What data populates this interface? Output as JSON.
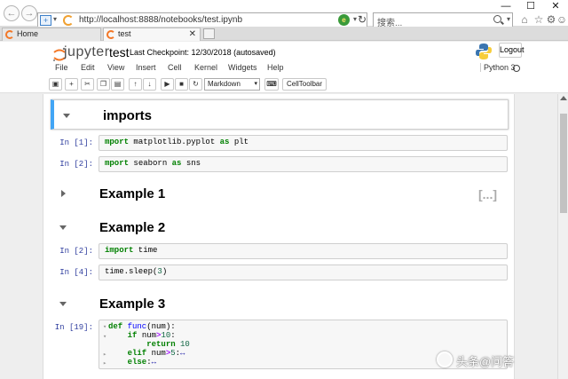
{
  "browser": {
    "url": "http://localhost:8888/notebooks/test.ipynb",
    "search_placeholder": "搜索...",
    "tabs": [
      {
        "label": "Home"
      },
      {
        "label": "test"
      }
    ],
    "window_controls": {
      "minimize": "—",
      "maximize": "☐",
      "close": "✕"
    }
  },
  "jupyter": {
    "logo_text": "jupyter",
    "notebook_name": "test",
    "checkpoint": "Last Checkpoint: 12/30/2018 (autosaved)",
    "logout_label": "Logout",
    "kernel_name": "Python 3",
    "menu": [
      "File",
      "Edit",
      "View",
      "Insert",
      "Cell",
      "Kernel",
      "Widgets",
      "Help"
    ],
    "toolbar": {
      "cell_type": "Markdown",
      "celltoolbar_label": "CellToolbar"
    }
  },
  "cells": {
    "h_imports": "imports",
    "c1_prompt": "In [1]:",
    "c1_code": {
      "kw1": "mport",
      "rest": " matplotlib.pyplot ",
      "kw2": "as",
      "alias": " plt"
    },
    "c2_prompt": "In [2]:",
    "c2_code": {
      "kw1": "mport",
      "rest": " seaborn ",
      "kw2": "as",
      "alias": " sns"
    },
    "h_example1": "Example 1",
    "hidden_marker": "[...]",
    "h_example2": "Example 2",
    "c3_prompt": "In [2]:",
    "c3_code": {
      "kw": "import",
      "rest": " time"
    },
    "c4_prompt": "In [4]:",
    "c4_code": {
      "pre": "time.sleep(",
      "num": "3",
      "post": ")"
    },
    "h_example3": "Example 3",
    "c5_prompt": "In [19]:",
    "c5_code": {
      "l1_kw": "def",
      "l1_fn": "func",
      "l1_rest": "(num):",
      "l2_kw": "if",
      "l2_rest": " num",
      "l2_op": ">",
      "l2_num": "10",
      "l2_end": ":",
      "l3_kw": "return",
      "l3_num": " 10",
      "l4_kw": "elif",
      "l4_rest": " num",
      "l4_op": ">",
      "l4_num": "5",
      "l4_end": ":",
      "l4_fold": "↔",
      "l5_kw": "else",
      "l5_end": ":",
      "l5_fold": "↔"
    }
  },
  "watermark": "头条@问答"
}
